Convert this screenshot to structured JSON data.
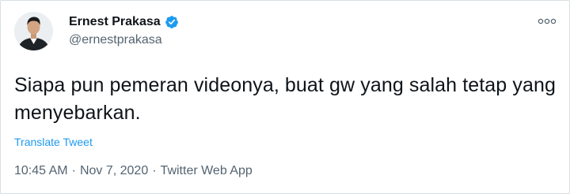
{
  "author": {
    "display_name": "Ernest Prakasa",
    "username": "@ernestprakasa",
    "verified": true,
    "avatar_icon": "profile-photo"
  },
  "tweet": {
    "text": "Siapa pun pemeran videonya, buat gw yang salah tetap yang menyebarkan.",
    "translate_label": "Translate Tweet",
    "time": "10:45 AM",
    "separator": "·",
    "date": "Nov 7, 2020",
    "source": "Twitter Web App"
  },
  "icons": {
    "verified": "verified-badge-icon",
    "more": "more-options-icon"
  },
  "colors": {
    "link": "#1d9bf0",
    "verified": "#1d9bf0",
    "secondary_text": "#536471",
    "primary_text": "#0f1419"
  }
}
